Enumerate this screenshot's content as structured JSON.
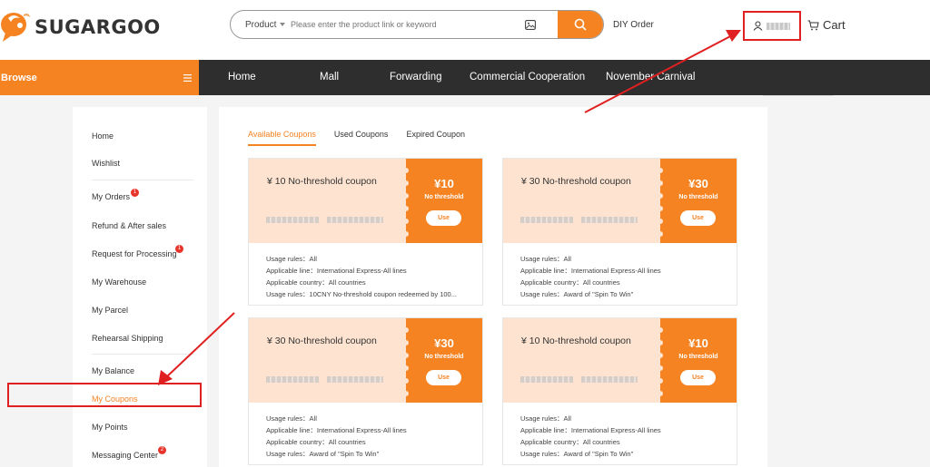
{
  "brand": {
    "name": "SUGARGOO",
    "accent": "#f58322",
    "annotation_red": "#e02020"
  },
  "search": {
    "type_label": "Product",
    "placeholder": "Please enter the product link or keyword",
    "image_icon": "image-search-icon",
    "search_icon": "magnifier-icon"
  },
  "header": {
    "diy_order": "DIY Order",
    "cart": "Cart"
  },
  "nav": {
    "browse": "Browse",
    "browse_icon": "menu-icon",
    "items": [
      "Home",
      "Mall",
      "Forwarding",
      "Commercial Cooperation",
      "November Carnival"
    ]
  },
  "sidebar": {
    "items": [
      {
        "label": "Home"
      },
      {
        "label": "Wishlist"
      },
      {
        "label": "My Orders",
        "badge": "1"
      },
      {
        "label": "Refund & After sales"
      },
      {
        "label": "Request for Processing",
        "badge": "1"
      },
      {
        "label": "My Warehouse"
      },
      {
        "label": "My Parcel"
      },
      {
        "label": "Rehearsal Shipping"
      },
      {
        "label": "My Balance"
      },
      {
        "label": "My Coupons",
        "active": true
      },
      {
        "label": "My Points"
      },
      {
        "label": "Messaging Center",
        "badge": "2"
      }
    ]
  },
  "tabs": [
    "Available Coupons",
    "Used Coupons",
    "Expired Coupon"
  ],
  "coupons": [
    {
      "title": "¥ 10 No-threshold coupon",
      "amount": "¥10",
      "threshold": "No threshold",
      "use": "Use",
      "rules": [
        "Usage rules：All",
        "Applicable line：International Express-All lines",
        "Applicable country：All countries",
        "Usage rules：10CNY No-threshold coupon redeemed by 100..."
      ]
    },
    {
      "title": "¥ 30 No-threshold coupon",
      "amount": "¥30",
      "threshold": "No threshold",
      "use": "Use",
      "rules": [
        "Usage rules：All",
        "Applicable line：International Express-All lines",
        "Applicable country：All countries",
        "Usage rules：Award of \"Spin To Win\""
      ]
    },
    {
      "title": "¥ 30 No-threshold coupon",
      "amount": "¥30",
      "threshold": "No threshold",
      "use": "Use",
      "rules": [
        "Usage rules：All",
        "Applicable line：International Express-All lines",
        "Applicable country：All countries",
        "Usage rules：Award of \"Spin To Win\""
      ]
    },
    {
      "title": "¥ 10 No-threshold coupon",
      "amount": "¥10",
      "threshold": "No threshold",
      "use": "Use",
      "rules": [
        "Usage rules：All",
        "Applicable line：International Express-All lines",
        "Applicable country：All countries",
        "Usage rules：Award of \"Spin To Win\""
      ]
    }
  ]
}
